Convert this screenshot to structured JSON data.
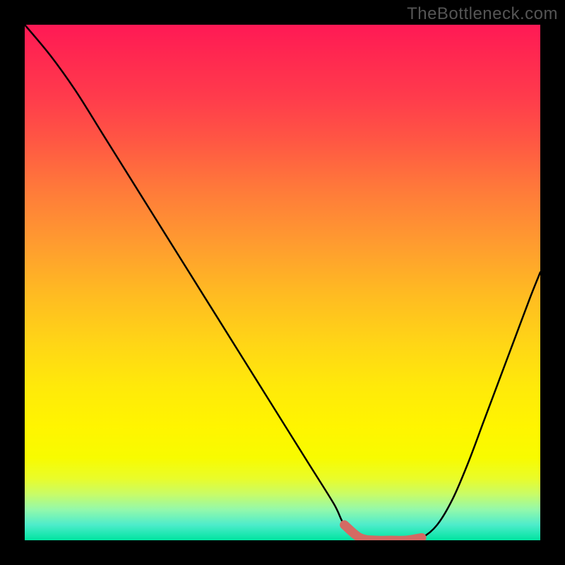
{
  "watermark": "TheBottleneck.com",
  "chart_data": {
    "type": "line",
    "title": "",
    "xlabel": "",
    "ylabel": "",
    "xlim": [
      0,
      100
    ],
    "ylim": [
      0,
      100
    ],
    "grid": false,
    "legend": false,
    "series": [
      {
        "name": "curve",
        "x": [
          0,
          5,
          10,
          15,
          20,
          25,
          30,
          35,
          40,
          45,
          50,
          55,
          60,
          62,
          65,
          68,
          71,
          74,
          77,
          80,
          83,
          86,
          89,
          92,
          95,
          98,
          100
        ],
        "values": [
          100,
          94,
          87,
          79,
          71,
          63,
          55,
          47,
          39,
          31,
          23,
          15,
          7,
          3,
          0.5,
          0,
          0,
          0,
          0.5,
          3,
          8,
          15,
          23,
          31,
          39,
          47,
          52
        ]
      },
      {
        "name": "trough-marker",
        "x": [
          62,
          65,
          68,
          71,
          74,
          77
        ],
        "values": [
          3,
          0.5,
          0,
          0,
          0,
          0.5
        ]
      }
    ],
    "colors": {
      "curve": "#000000",
      "trough_marker": "#d46a63",
      "gradient_top": "#ff1955",
      "gradient_mid": "#ffd616",
      "gradient_bottom": "#00e4a0"
    }
  },
  "frame": {
    "outer_w": 800,
    "outer_h": 800,
    "inner_x": 35,
    "inner_y": 35,
    "inner_w": 730,
    "inner_h": 730
  }
}
